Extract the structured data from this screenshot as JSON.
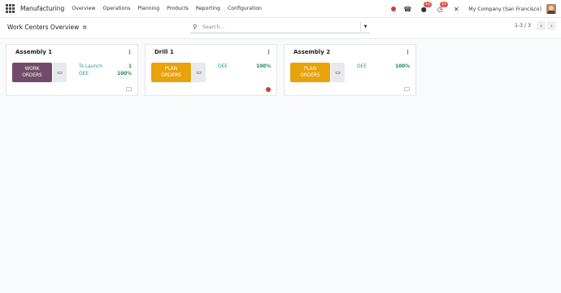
{
  "app": {
    "brand": "Manufacturing"
  },
  "nav": {
    "items": [
      "Overview",
      "Operations",
      "Planning",
      "Products",
      "Reporting",
      "Configuration"
    ]
  },
  "systray": {
    "activity_badge": "14",
    "messages_badge": "11",
    "company": "My Company (San Francisco)"
  },
  "control": {
    "title": "Work Centers Overview",
    "search_placeholder": "Search...",
    "pager": "1-3 / 3"
  },
  "cards": [
    {
      "name": "Assembly 1",
      "button_label": "WORK ORDERS",
      "button_color": "#714b67",
      "stats": [
        {
          "label": "To Launch",
          "value": "1"
        },
        {
          "label": "OEE",
          "value": "100%"
        }
      ],
      "status": "idle"
    },
    {
      "name": "Drill 1",
      "button_label": "PLAN ORDERS",
      "button_color": "#e8a20a",
      "stats": [
        {
          "label": "OEE",
          "value": "100%"
        }
      ],
      "status": "blocked"
    },
    {
      "name": "Assembly 2",
      "button_label": "PLAN ORDERS",
      "button_color": "#e8a20a",
      "stats": [
        {
          "label": "OEE",
          "value": "100%"
        }
      ],
      "status": "idle"
    }
  ],
  "colors": {
    "stat_label": "#1a9c9a",
    "stat_value": "#198754",
    "blocked": "#d23f3a"
  }
}
